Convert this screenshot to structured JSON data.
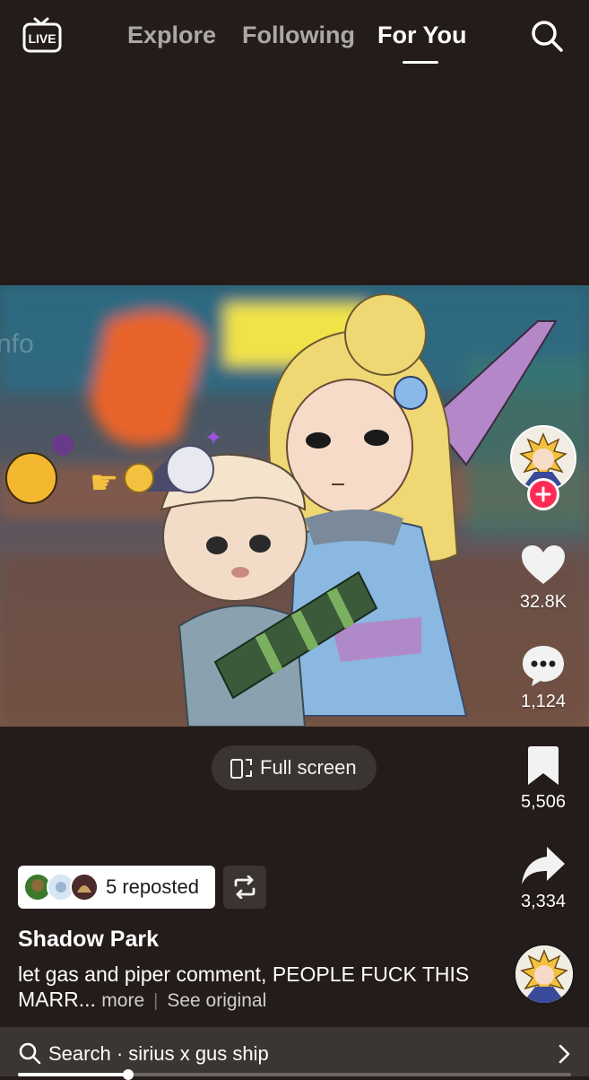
{
  "nav": {
    "live_label": "LIVE",
    "tabs": [
      {
        "label": "Explore",
        "active": false
      },
      {
        "label": "Following",
        "active": false
      },
      {
        "label": "For You",
        "active": true
      }
    ],
    "search_icon": "search-icon"
  },
  "rail": {
    "likes": "32.8K",
    "comments": "1,124",
    "bookmarks": "5,506",
    "shares": "3,334"
  },
  "fullscreen": {
    "label": "Full screen"
  },
  "repost": {
    "label": "5 reposted"
  },
  "post": {
    "author": "Shadow Park",
    "caption": "let gas and piper comment, PEOPLE FUCK THIS MARR...",
    "more_label": "more",
    "see_original_label": "See original"
  },
  "search_bar": {
    "label": "Search · sirius x gus ship"
  },
  "playback": {
    "progress": 0.2
  },
  "colors": {
    "background": "#241c1a",
    "follow_plus": "#fe2c55",
    "search_bar": "#3b3533"
  }
}
